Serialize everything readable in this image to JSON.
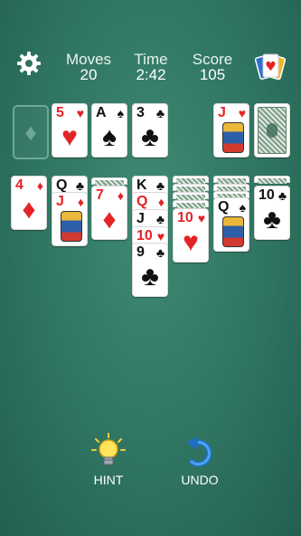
{
  "header": {
    "moves_label": "Moves",
    "moves_value": "20",
    "time_label": "Time",
    "time_value": "2:42",
    "score_label": "Score",
    "score_value": "105"
  },
  "foundations": [
    {
      "rank": "",
      "suit": "♦",
      "empty": true
    },
    {
      "rank": "5",
      "suit": "♥"
    },
    {
      "rank": "A",
      "suit": "♠"
    },
    {
      "rank": "3",
      "suit": "♣"
    }
  ],
  "waste": {
    "rank": "J",
    "suit": "♥"
  },
  "tableau": {
    "col1": [
      {
        "rank": "4",
        "suit": "♦"
      }
    ],
    "col2": [
      {
        "rank": "Q",
        "suit": "♣"
      },
      {
        "rank": "J",
        "suit": "♦"
      }
    ],
    "col3": [
      {
        "rank": "7",
        "suit": "♦"
      }
    ],
    "col4": [
      {
        "rank": "K",
        "suit": "♣"
      },
      {
        "rank": "Q",
        "suit": "♦"
      },
      {
        "rank": "J",
        "suit": "♣"
      },
      {
        "rank": "10",
        "suit": "♥"
      },
      {
        "rank": "9",
        "suit": "♣"
      }
    ],
    "col5": [
      {
        "rank": "10",
        "suit": "♥"
      }
    ],
    "col6": [
      {
        "rank": "Q",
        "suit": "♠"
      }
    ],
    "col7": [
      {
        "rank": "10",
        "suit": "♣"
      }
    ]
  },
  "controls": {
    "hint_label": "HINT",
    "undo_label": "UNDO"
  },
  "colors": {
    "felt": "#2f7461",
    "red_suit": "#e32427",
    "black_suit": "#111111"
  }
}
